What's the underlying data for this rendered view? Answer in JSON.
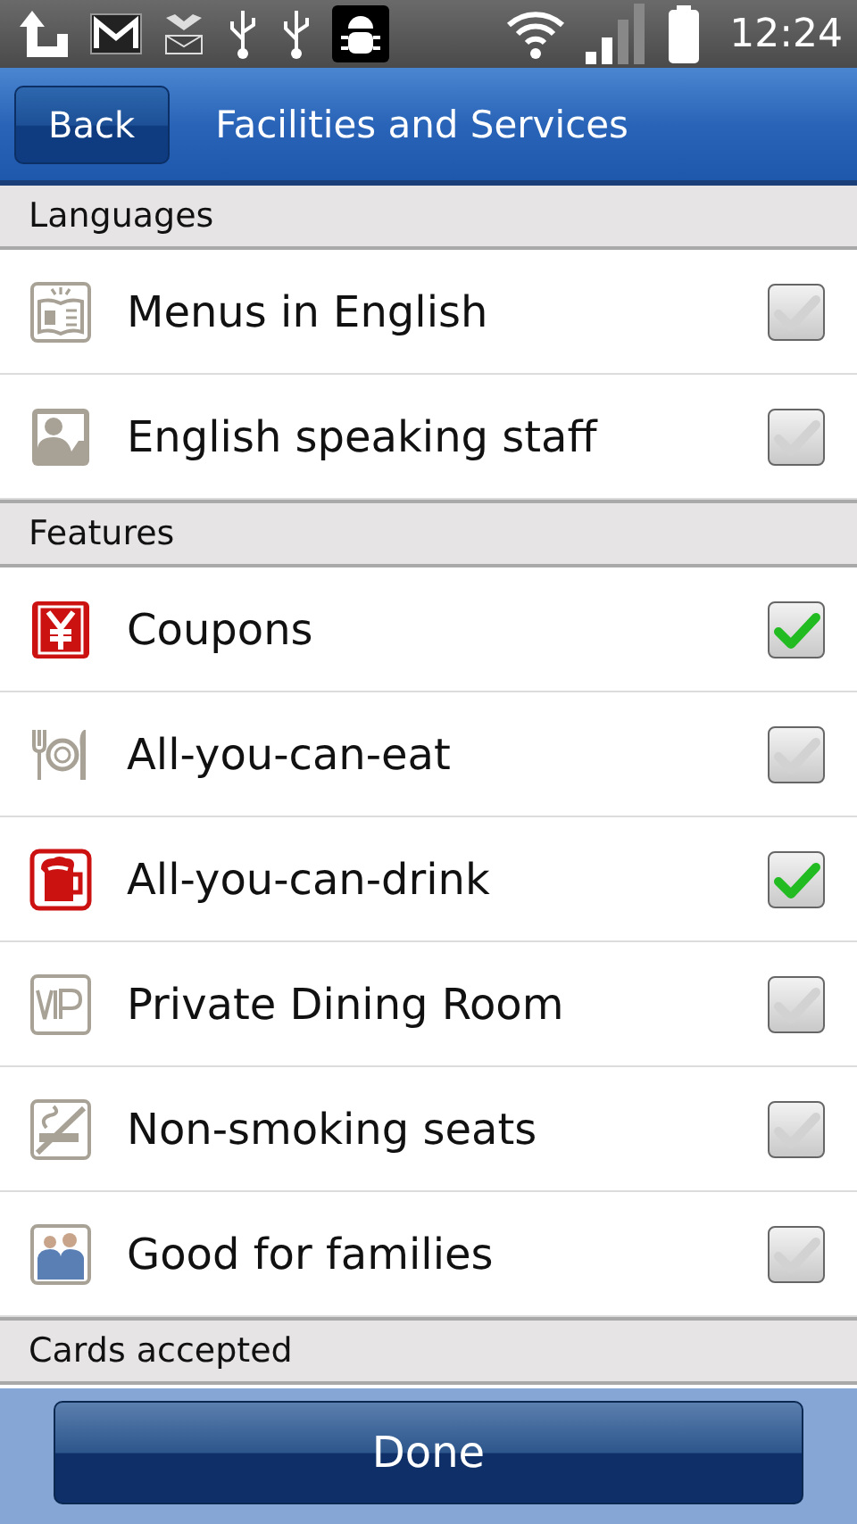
{
  "status_bar": {
    "time": "12:24"
  },
  "title_bar": {
    "back_button": "Back",
    "title": "Facilities and Services"
  },
  "sections": [
    {
      "title": "Languages",
      "items": [
        {
          "label": "Menus in English",
          "kind": "menu",
          "checked": false
        },
        {
          "label": "English speaking staff",
          "kind": "staff",
          "checked": false
        }
      ]
    },
    {
      "title": "Features",
      "items": [
        {
          "label": "Coupons",
          "kind": "coupon",
          "checked": true
        },
        {
          "label": "All-you-can-eat",
          "kind": "buffet",
          "checked": false
        },
        {
          "label": "All-you-can-drink",
          "kind": "drink",
          "checked": true
        },
        {
          "label": "Private Dining Room",
          "kind": "vip",
          "checked": false
        },
        {
          "label": "Non-smoking seats",
          "kind": "nosmoking",
          "checked": false
        },
        {
          "label": "Good for families",
          "kind": "family",
          "checked": false
        }
      ]
    },
    {
      "title": "Cards accepted"
    }
  ],
  "done_button": "Done"
}
